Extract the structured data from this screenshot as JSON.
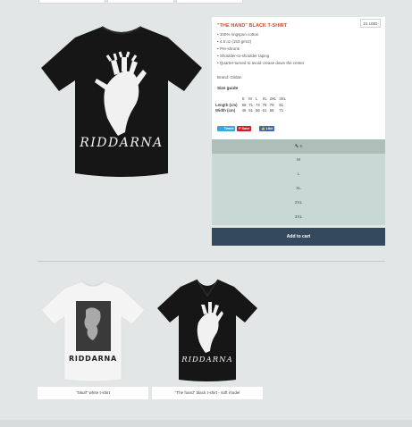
{
  "product": {
    "title": "\"THE HAND\" BLACK T-SHIRT",
    "price": "21 USD",
    "features": [
      "• 100% ringspun cotton",
      "• 4.5 oz (153 g/m2)",
      "• Pre-shrunk",
      "• Shoulder-to-shoulder taping",
      "• Quarter-turned to avoid crease down the center"
    ],
    "brand": "Brand: Gildan",
    "size_guide_label": "Size guide",
    "hero_print_text": "RIDDARNA"
  },
  "size_table": {
    "headers": [
      "",
      "S",
      "M",
      "L",
      "XL",
      "2XL",
      "3XL"
    ],
    "rows": [
      [
        "Length (cm)",
        "69",
        "71",
        "74",
        "76",
        "79",
        "81"
      ],
      [
        "Width (cm)",
        "46",
        "51",
        "56",
        "61",
        "66",
        "71"
      ]
    ]
  },
  "share": {
    "twitter": "Tweet",
    "pinterest": "Save",
    "facebook": "Like"
  },
  "size_options": [
    "S",
    "M",
    "L",
    "XL",
    "2XL",
    "3XL"
  ],
  "selected_size": "S",
  "add_to_cart": "Add to cart",
  "related": [
    {
      "label": "\"Skull\" white t-shirt",
      "print_text": "RIDDARNA"
    },
    {
      "label": "\"The hand\" black t-shirt - soft model",
      "print_text": "RIDDARNA"
    }
  ],
  "colors": {
    "title": "#d9451f",
    "option_bg": "#c8d8d4",
    "option_selected": "#aebfba",
    "cart_button": "#34495e",
    "page_bg": "#e3e6e6"
  }
}
